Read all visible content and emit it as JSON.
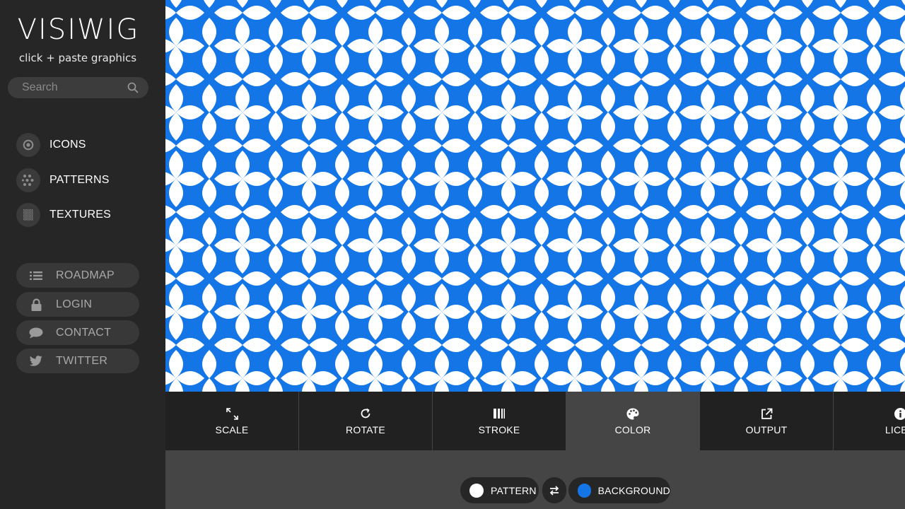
{
  "sidebar": {
    "logo": "VISIWIG",
    "tagline": "click + paste graphics",
    "search_placeholder": "Search",
    "nav": [
      {
        "label": "ICONS",
        "icon": "target-icon"
      },
      {
        "label": "PATTERNS",
        "icon": "dots-grid-icon"
      },
      {
        "label": "TEXTURES",
        "icon": "texture-icon"
      }
    ],
    "links": [
      {
        "label": "ROADMAP",
        "icon": "list-icon"
      },
      {
        "label": "LOGIN",
        "icon": "lock-icon"
      },
      {
        "label": "CONTACT",
        "icon": "chat-bubble-icon"
      },
      {
        "label": "TWITTER",
        "icon": "twitter-bird-icon"
      }
    ]
  },
  "pattern": {
    "name": "petal-lattice",
    "pattern_color": "#ffffff",
    "background_color": "#1475e6"
  },
  "toolbar": {
    "tools": [
      {
        "label": "SCALE",
        "icon": "scale-arrows-icon",
        "active": false
      },
      {
        "label": "ROTATE",
        "icon": "rotate-icon",
        "active": false
      },
      {
        "label": "STROKE",
        "icon": "stroke-bars-icon",
        "active": false
      },
      {
        "label": "COLOR",
        "icon": "palette-icon",
        "active": true
      },
      {
        "label": "OUTPUT",
        "icon": "external-link-icon",
        "active": false
      },
      {
        "label": "LICEN",
        "icon": "info-icon",
        "active": false
      }
    ]
  },
  "color_panel": {
    "pattern_label": "PATTERN",
    "pattern_swatch": "#ffffff",
    "background_label": "BACKGROUND",
    "background_swatch": "#1475e6",
    "swap_icon": "swap-arrows-icon"
  }
}
